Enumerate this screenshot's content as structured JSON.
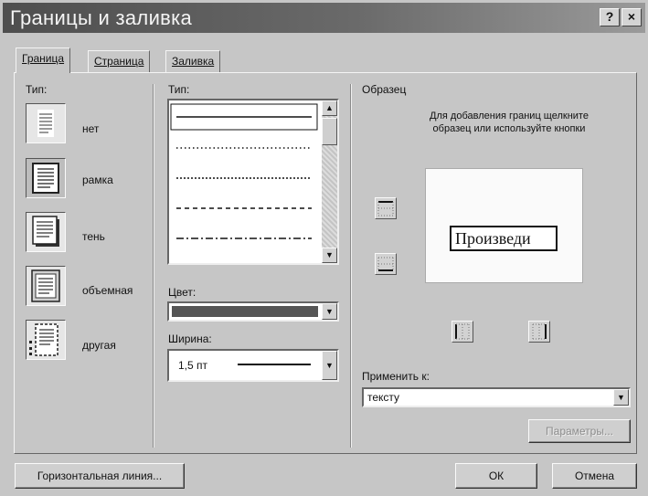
{
  "window": {
    "title": "Границы и заливка",
    "help_label": "?",
    "close_label": "×"
  },
  "tabs": [
    {
      "label": "Граница",
      "active": true
    },
    {
      "label": "Страница",
      "active": false
    },
    {
      "label": "Заливка",
      "active": false
    }
  ],
  "setting": {
    "label": "Тип:",
    "presets": [
      {
        "label": "нет",
        "icon": "no-border-icon",
        "selected": false
      },
      {
        "label": "рамка",
        "icon": "box-border-icon",
        "selected": true
      },
      {
        "label": "тень",
        "icon": "shadow-border-icon",
        "selected": false
      },
      {
        "label": "объемная",
        "icon": "3d-border-icon",
        "selected": false
      },
      {
        "label": "другая",
        "icon": "custom-border-icon",
        "selected": false
      }
    ]
  },
  "style": {
    "label": "Тип:",
    "line_styles": [
      "solid",
      "dotted",
      "dashed-fine",
      "dashed",
      "dash-dot"
    ]
  },
  "color": {
    "label": "Цвет:",
    "value": "",
    "swatch": "#555555"
  },
  "width": {
    "label": "Ширина:",
    "value": "1,5 пт"
  },
  "preview": {
    "group_label": "Образец",
    "hint": "Для добавления границ щелкните образец или используйте кнопки",
    "sample_text": "Произведи"
  },
  "apply_to": {
    "label": "Применить к:",
    "value": "тексту"
  },
  "buttons": {
    "options": "Параметры...",
    "horizontal_line": "Горизонтальная линия...",
    "ok": "ОК",
    "cancel": "Отмена"
  }
}
